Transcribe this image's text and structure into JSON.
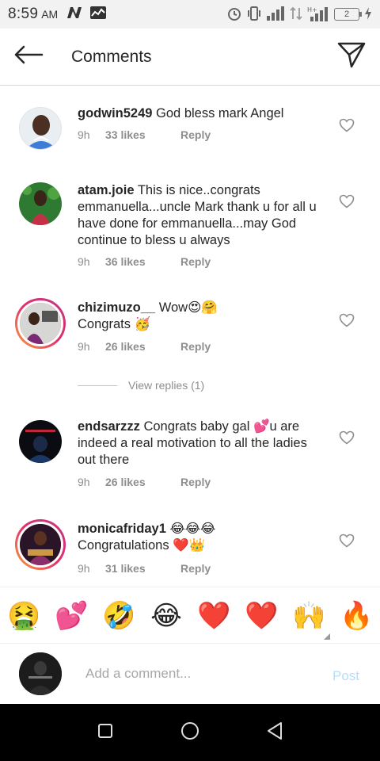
{
  "status_bar": {
    "time": "8:59",
    "ampm": "AM",
    "battery": "2"
  },
  "header": {
    "title": "Comments"
  },
  "comments": [
    {
      "username": "godwin5249",
      "text": "God bless mark Angel",
      "time": "9h",
      "likes": "33 likes",
      "reply": "Reply"
    },
    {
      "username": "atam.joie",
      "text": "This is nice..congrats emmanuella...uncle Mark thank u for all u have done for emmanuella...may God continue to bless u always",
      "time": "9h",
      "likes": "36 likes",
      "reply": "Reply"
    },
    {
      "username": "chizimuzo__",
      "text": "Wow😍🤗",
      "text2": "Congrats 🥳",
      "time": "9h",
      "likes": "26 likes",
      "reply": "Reply"
    },
    {
      "username": "endsarzzz",
      "text": "Congrats baby gal 💕u are indeed a real motivation to all the ladies out there",
      "time": "9h",
      "likes": "26 likes",
      "reply": "Reply"
    },
    {
      "username": "monicafriday1",
      "text": "😂😂😂",
      "text2": "Congratulations ❤️👑",
      "time": "9h",
      "likes": "31 likes",
      "reply": "Reply"
    }
  ],
  "view_replies": "View replies (1)",
  "emoji_bar": [
    "🤮",
    "💕",
    "🤣",
    "😂",
    "❤️",
    "❤️",
    "🙌",
    "🔥"
  ],
  "add_comment": {
    "placeholder": "Add a comment...",
    "post_label": "Post"
  },
  "colors": {
    "text": "#262626",
    "meta": "#8e8e8e",
    "post": "#b2dffc",
    "heart_red": "#e8112d"
  },
  "icons": {
    "back": "arrow-left-icon",
    "send": "paper-plane-icon",
    "like": "heart-outline-icon",
    "nav_recent": "square-icon",
    "nav_home": "circle-icon",
    "nav_back": "triangle-back-icon"
  }
}
